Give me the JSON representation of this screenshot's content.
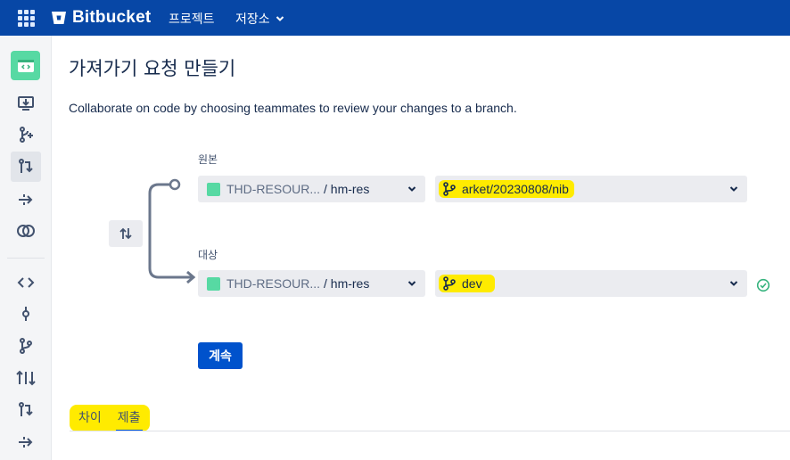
{
  "topbar": {
    "brand": "Bitbucket",
    "nav_projects": "프로젝트",
    "nav_repositories": "저장소"
  },
  "page": {
    "title": "가져가기 요청 만들기",
    "description": "Collaborate on code by choosing teammates to review your changes to a branch."
  },
  "source": {
    "label": "원본",
    "repo_project": "THD-RESOUR...",
    "repo_name": "/ hm-res",
    "branch": "arket/20230808/nib"
  },
  "target": {
    "label": "대상",
    "repo_project": "THD-RESOUR...",
    "repo_name": "/ hm-res",
    "branch": "dev"
  },
  "actions": {
    "continue_label": "계속"
  },
  "tabs": [
    {
      "label": "차이"
    },
    {
      "label": "제출"
    }
  ],
  "colors": {
    "header": "#0747a6",
    "primary": "#0052cc",
    "repo_green": "#57d9a3",
    "highlight": "#ffeb00",
    "success": "#36b37e"
  },
  "icons": {
    "apps": "app-switcher-icon",
    "logo": "bitbucket-logo-icon",
    "swap": "swap-arrows-icon",
    "branch": "branch-icon",
    "success": "check-circle-icon"
  }
}
